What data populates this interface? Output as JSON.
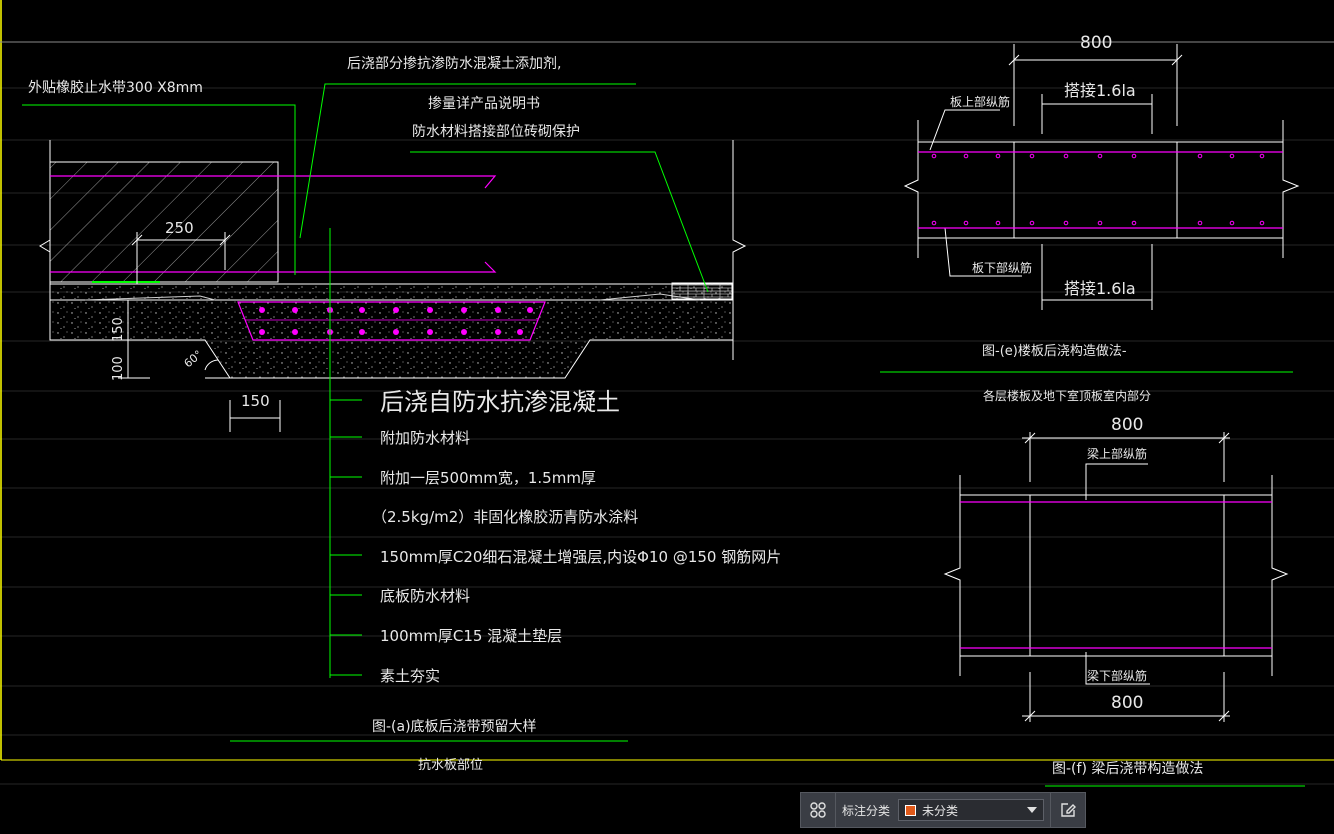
{
  "colors": {
    "background": "#000000",
    "line": "#ffffff",
    "rebar": "#ff00ff",
    "leader": "#00ff00",
    "border": "#ffff00"
  },
  "detail_a": {
    "note_waterstop": "外贴橡胶止水带300 X8mm",
    "note_additive_1": "后浇部分掺抗渗防水混凝土添加剂,",
    "note_additive_2": "掺量详产品说明书",
    "note_brick": "防水材料搭接部位砖砌保护",
    "dim_250": "250",
    "dim_150_vertical": "150",
    "dim_100": "100",
    "angle_60": "60°",
    "dim_150_bottom": "150",
    "layers": [
      "后浇自防水抗渗混凝土",
      "附加防水材料",
      "附加一层500mm宽，1.5mm厚",
      "（2.5kg/m2）非固化橡胶沥青防水涂料",
      "150mm厚C20细石混凝土增强层,内设Φ10 @150 钢筋网片",
      "底板防水材料",
      "100mm厚C15 混凝土垫层",
      "素土夯实"
    ],
    "caption": "图-(a)底板后浇带预留大样",
    "sub_caption": "抗水板部位"
  },
  "detail_e": {
    "dim_800": "800",
    "lap_top": "搭接1.6la",
    "lap_bottom": "搭接1.6la",
    "top_rebar": "板上部纵筋",
    "bottom_rebar": "板下部纵筋",
    "caption": "图-(e)楼板后浇构造做法-",
    "sub_caption": "各层楼板及地下室顶板室内部分"
  },
  "detail_f": {
    "dim_800_top": "800",
    "dim_800_bottom": "800",
    "top_rebar": "梁上部纵筋",
    "bottom_rebar": "梁下部纵筋",
    "caption": "图-(f) 梁后浇带构造做法"
  },
  "toolbar": {
    "label": "标注分类",
    "selected": "未分类",
    "swatch_color": "#e05a1a"
  }
}
